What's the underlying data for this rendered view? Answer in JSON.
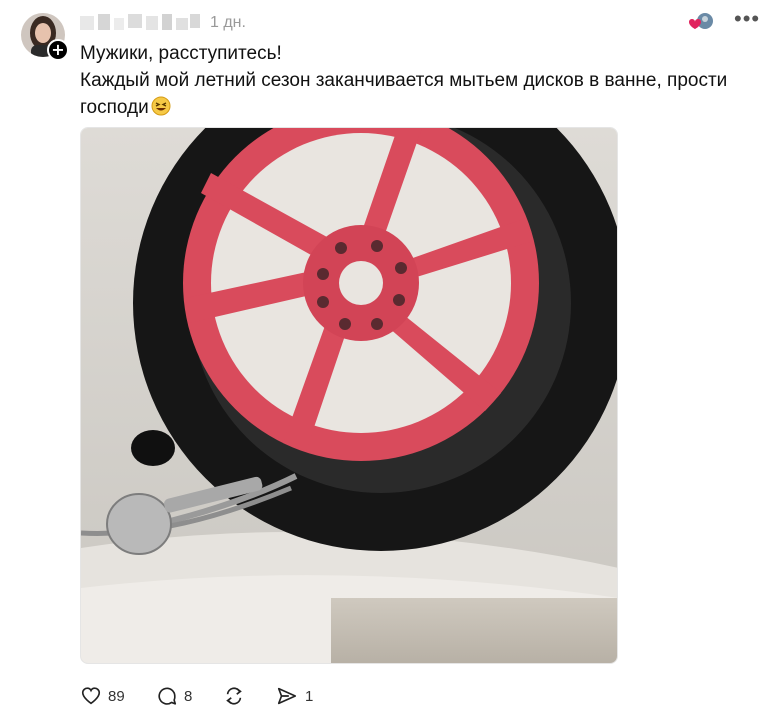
{
  "post": {
    "time": "1 дн.",
    "follow_symbol": "+",
    "text_lines": [
      "Мужики, расступитесь!",
      "Каждый мой летний сезон заканчивается мытьем дисков в ванне, прости господи"
    ],
    "emoji": "laughing-face-emoji"
  },
  "actions": {
    "likes": "89",
    "replies": "8",
    "repost_label": "",
    "shares": "1"
  },
  "icons": [
    "heart-icon",
    "reply-icon",
    "repost-icon",
    "share-icon",
    "more-icon",
    "plus-icon"
  ],
  "colors": {
    "rim": "#d94b5c",
    "tire": "#1a1a1a",
    "muted_text": "#999999",
    "reaction_heart": "#e0245e"
  }
}
